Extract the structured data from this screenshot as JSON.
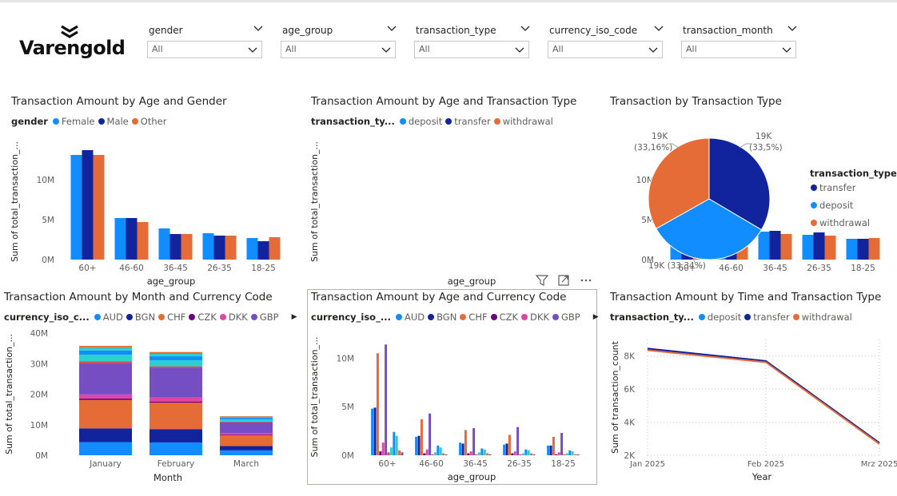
{
  "logo": {
    "text": "Varengold"
  },
  "slicers": [
    {
      "title": "gender",
      "value": "All"
    },
    {
      "title": "age_group",
      "value": "All"
    },
    {
      "title": "transaction_type",
      "value": "All"
    },
    {
      "title": "currency_iso_code",
      "value": "All"
    },
    {
      "title": "transaction_month",
      "value": "All"
    }
  ],
  "colors": {
    "blue": "#118DFF",
    "navy": "#12239E",
    "orange": "#E66C37",
    "purple": "#6B007B",
    "pink": "#E044A7",
    "violet": "#744EC2",
    "teal": "#2ACFCF",
    "gray_axis": "#605e5c"
  },
  "visuals": {
    "v1": {
      "title": "Transaction Amount by Age and Gender",
      "legend_title": "gender",
      "legend": [
        "Female",
        "Male",
        "Other"
      ]
    },
    "v2": {
      "title": "Transaction Amount by Age and Transaction Type",
      "legend_title": "transaction_ty...",
      "legend": [
        "deposit",
        "transfer",
        "withdrawal"
      ]
    },
    "v3": {
      "title": "Transaction by Transaction Type",
      "legend_title": "transaction_type",
      "legend": [
        "transfer",
        "deposit",
        "withdrawal"
      ]
    },
    "v4": {
      "title": "Transaction Amount by Month and Currency Code",
      "legend_title": "currency_iso_c...",
      "legend": [
        "AUD",
        "BGN",
        "CHF",
        "CZK",
        "DKK",
        "GBP"
      ],
      "more": "▶"
    },
    "v5": {
      "title": "Transaction Amount by Age and Currency Code",
      "legend_title": "currency_iso_...",
      "legend": [
        "AUD",
        "BGN",
        "CHF",
        "CZK",
        "DKK",
        "GBP"
      ],
      "more": "▶"
    },
    "v6": {
      "title": "Transaction Amount by Time and Transaction Type",
      "legend_title": "transaction_ty...",
      "legend": [
        "deposit",
        "transfer",
        "withdrawal"
      ]
    }
  },
  "chart_data": [
    {
      "type": "bar",
      "title": "Transaction Amount by Age and Gender",
      "xlabel": "age_group",
      "ylabel": "Sum of total_transaction_...",
      "categories": [
        "60+",
        "46-60",
        "36-45",
        "26-35",
        "18-25"
      ],
      "series": [
        {
          "name": "Female",
          "values": [
            13.1,
            5.2,
            3.9,
            3.3,
            2.7
          ]
        },
        {
          "name": "Male",
          "values": [
            13.7,
            5.2,
            3.2,
            3.0,
            2.3
          ]
        },
        {
          "name": "Other",
          "values": [
            13.1,
            4.7,
            3.2,
            3.0,
            2.8
          ]
        }
      ],
      "yticks": [
        "0M",
        "5M",
        "10M"
      ],
      "ylim": [
        0,
        14.5
      ],
      "yunit": "M"
    },
    {
      "type": "bar",
      "title": "Transaction Amount by Age and Transaction Type",
      "xlabel": "age_group",
      "ylabel": "Sum of total_transaction_...",
      "categories": [
        "60+",
        "46-60",
        "36-45",
        "26-35",
        "18-25"
      ],
      "series": [
        {
          "name": "deposit",
          "values": [
            13.3,
            4.9,
            3.5,
            3.1,
            2.6
          ]
        },
        {
          "name": "transfer",
          "values": [
            13.2,
            5.1,
            3.6,
            3.4,
            2.6
          ]
        },
        {
          "name": "withdrawal",
          "values": [
            13.1,
            4.9,
            3.2,
            3.0,
            2.7
          ]
        }
      ],
      "yticks": [
        "0M",
        "5M",
        "10M"
      ],
      "ylim": [
        0,
        14.5
      ],
      "yunit": "M"
    },
    {
      "type": "pie",
      "title": "Transaction by Transaction Type",
      "slices": [
        {
          "name": "transfer",
          "value": 33.5,
          "label": "19K\n(33,5%)"
        },
        {
          "name": "deposit",
          "value": 33.34,
          "label": "19K (33,34%)"
        },
        {
          "name": "withdrawal",
          "value": 33.16,
          "label": "19K\n(33,16%)"
        }
      ]
    },
    {
      "type": "bar",
      "stacked": true,
      "title": "Transaction Amount by Month and Currency Code",
      "xlabel": "Month",
      "ylabel": "Sum of total_transaction_...",
      "categories": [
        "January",
        "February",
        "March"
      ],
      "series": [
        {
          "name": "AUD",
          "values": [
            4.3,
            4.2,
            1.6
          ]
        },
        {
          "name": "BGN",
          "values": [
            4.5,
            4.3,
            1.4
          ]
        },
        {
          "name": "CHF",
          "values": [
            9.3,
            8.7,
            3.6
          ]
        },
        {
          "name": "CZK",
          "values": [
            0.5,
            0.4,
            0.2
          ]
        },
        {
          "name": "DKK",
          "values": [
            1.3,
            1.3,
            0.5
          ]
        },
        {
          "name": "GBP",
          "values": [
            10.2,
            9.7,
            3.5
          ]
        },
        {
          "name": "",
          "values": [
            0.6,
            0.5,
            0.2
          ]
        },
        {
          "name": "",
          "values": [
            2.2,
            2.0,
            0.8
          ]
        },
        {
          "name": "",
          "values": [
            1.4,
            1.3,
            0.5
          ]
        },
        {
          "name": "",
          "values": [
            0.9,
            0.8,
            0.3
          ]
        },
        {
          "name": "",
          "values": [
            0.6,
            0.6,
            0.2
          ]
        }
      ],
      "yticks": [
        "0M",
        "10M",
        "20M",
        "30M",
        "40M"
      ],
      "ylim": [
        0,
        40
      ],
      "yunit": "M"
    },
    {
      "type": "bar",
      "title": "Transaction Amount by Age and Currency Code",
      "xlabel": "age_group",
      "ylabel": "Sum of total_transaction_...",
      "categories": [
        "60+",
        "46-60",
        "36-45",
        "26-35",
        "18-25"
      ],
      "series": [
        {
          "name": "AUD",
          "values": [
            4.8,
            1.9,
            1.3,
            1.1,
            1.0
          ]
        },
        {
          "name": "BGN",
          "values": [
            4.9,
            2.0,
            1.2,
            1.2,
            1.0
          ]
        },
        {
          "name": "CHF",
          "values": [
            10.5,
            3.7,
            2.6,
            2.1,
            1.9
          ]
        },
        {
          "name": "CZK",
          "values": [
            0.4,
            0.2,
            0.2,
            0.2,
            0.1
          ]
        },
        {
          "name": "DKK",
          "values": [
            1.3,
            0.6,
            0.4,
            0.4,
            0.3
          ]
        },
        {
          "name": "GBP",
          "values": [
            11.4,
            4.3,
            2.8,
            2.9,
            2.3
          ]
        },
        {
          "name": "",
          "values": [
            0.3,
            0.1,
            0.1,
            0.1,
            0.1
          ]
        },
        {
          "name": "",
          "values": [
            0.8,
            0.3,
            0.3,
            0.2,
            0.2
          ]
        },
        {
          "name": "",
          "values": [
            2.4,
            1.0,
            0.7,
            0.6,
            0.5
          ]
        },
        {
          "name": "",
          "values": [
            2.0,
            0.8,
            0.6,
            0.5,
            0.4
          ]
        },
        {
          "name": "",
          "values": [
            0.5,
            0.2,
            0.2,
            0.2,
            0.1
          ]
        },
        {
          "name": "",
          "values": [
            0.3,
            0.1,
            0.1,
            0.1,
            0.1
          ]
        }
      ],
      "yticks": [
        "0M",
        "5M",
        "10M"
      ],
      "ylim": [
        0,
        12
      ],
      "yunit": "M"
    },
    {
      "type": "line",
      "title": "Transaction Amount by Time and Transaction Type",
      "xlabel": "Year",
      "ylabel": "Sum of transaction_count",
      "x": [
        "Jan 2025",
        "Feb 2025",
        "Mrz 2025"
      ],
      "series": [
        {
          "name": "deposit",
          "values": [
            8400,
            7650,
            2700
          ]
        },
        {
          "name": "transfer",
          "values": [
            8450,
            7700,
            2750
          ]
        },
        {
          "name": "withdrawal",
          "values": [
            8350,
            7620,
            2680
          ]
        }
      ],
      "yticks": [
        "2K",
        "4K",
        "6K",
        "8K"
      ],
      "ylim": [
        2000,
        9000
      ]
    }
  ]
}
